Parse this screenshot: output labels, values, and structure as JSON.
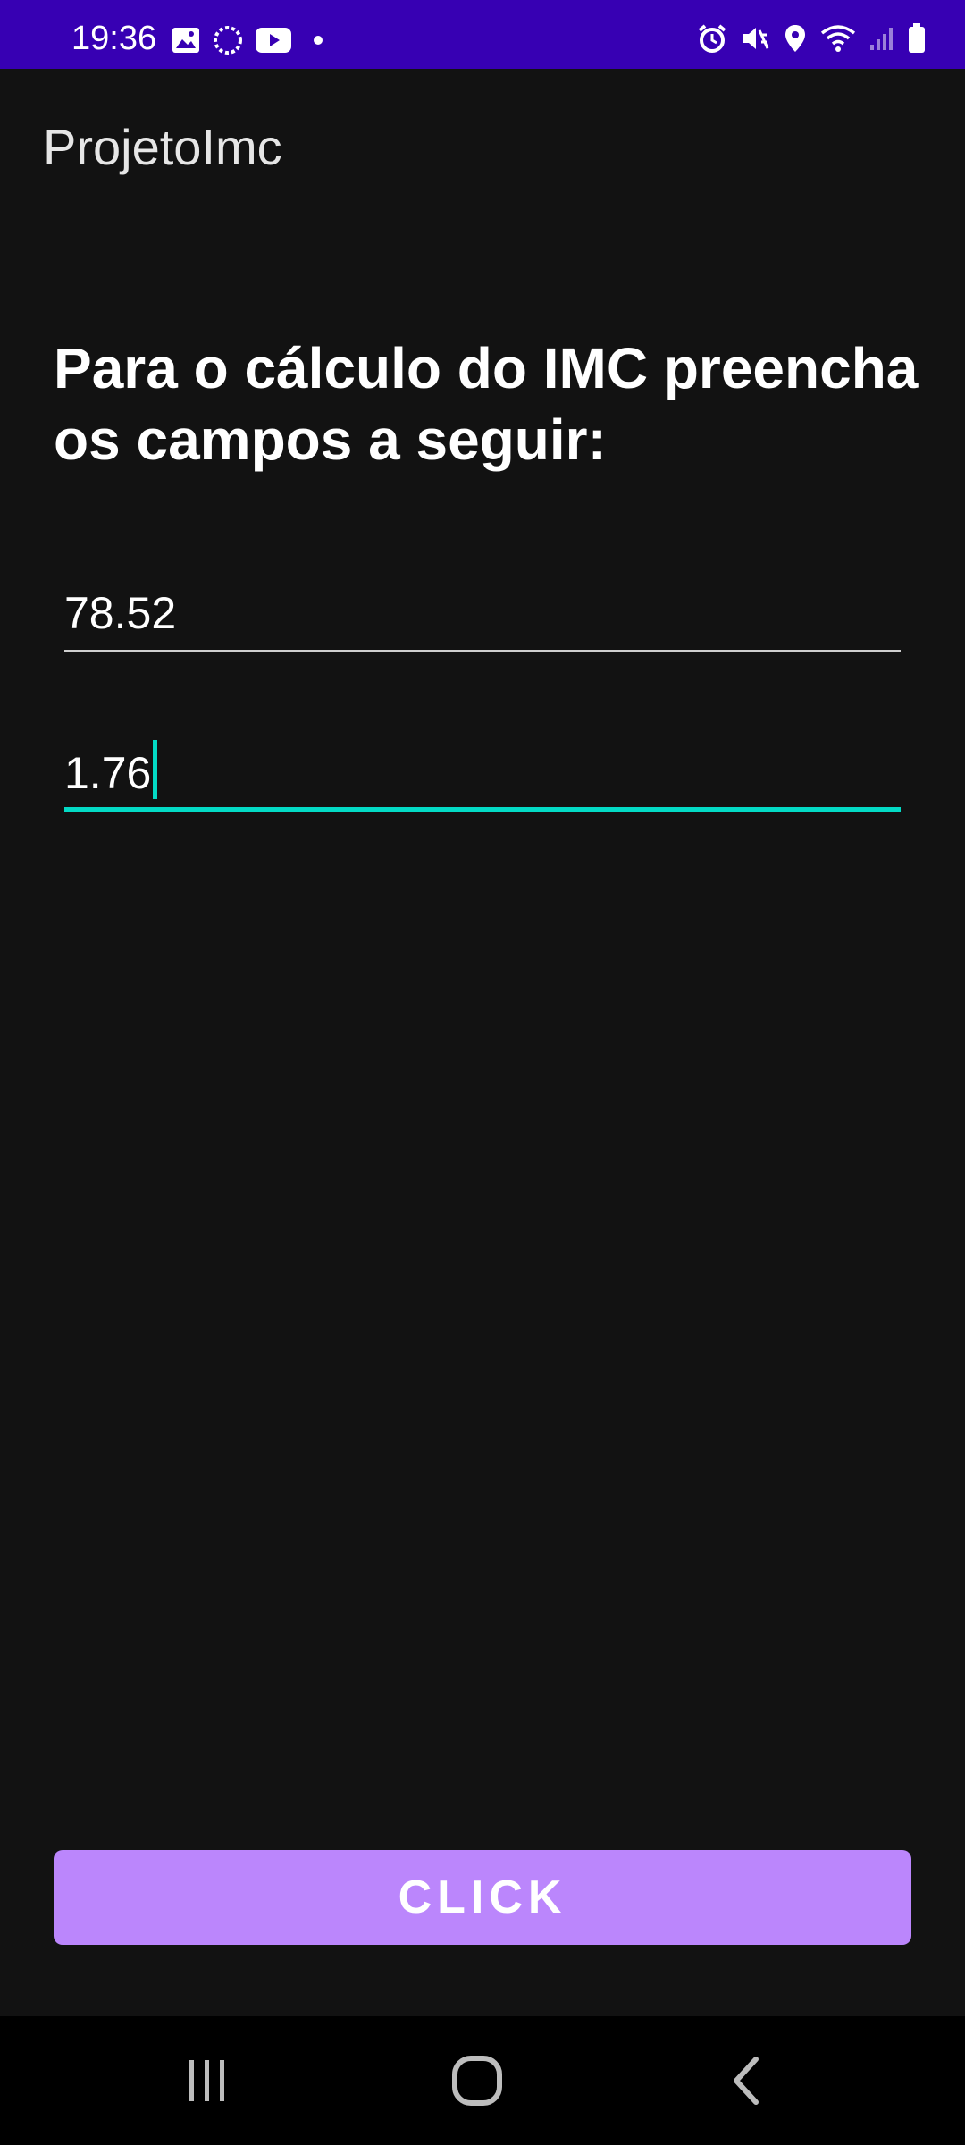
{
  "status_bar": {
    "time": "19:36",
    "left_icons": [
      "gallery-icon",
      "sync-icon",
      "youtube-icon",
      "notification-dot-icon"
    ],
    "right_icons": [
      "alarm-icon",
      "mute-icon",
      "location-icon",
      "wifi-icon",
      "signal-icon",
      "battery-icon"
    ]
  },
  "app_bar": {
    "title": "ProjetoImc"
  },
  "main": {
    "heading": "Para o cálculo do IMC preencha os campos a seguir:",
    "weight_field": {
      "value": "78.52"
    },
    "height_field": {
      "value": "1.76"
    },
    "click_button_label": "CLICK"
  },
  "nav_bar": {
    "buttons": [
      "recent-apps-icon",
      "home-icon",
      "back-icon"
    ]
  },
  "colors": {
    "status_bar": "#3700b3",
    "background": "#121212",
    "accent": "#03dac5",
    "button": "#bb86fc"
  }
}
